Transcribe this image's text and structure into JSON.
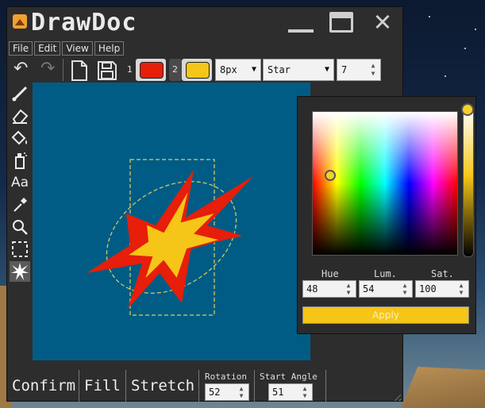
{
  "app": {
    "title": "DrawDoc"
  },
  "menu": [
    "File",
    "Edit",
    "View",
    "Help"
  ],
  "toolbar": {
    "color1_index": "1",
    "color2_index": "2",
    "color1": "#e61e0a",
    "color2": "#f5c518",
    "size_value": "8px",
    "shape_value": "Star",
    "points_value": "7"
  },
  "tools": [
    "brush-icon",
    "eraser-icon",
    "fill-bucket-icon",
    "spray-icon",
    "text-icon",
    "eyedropper-icon",
    "zoom-icon",
    "select-icon",
    "star-tool-icon"
  ],
  "tool_text": {
    "text_tool_glyph": "Aa"
  },
  "canvas": {
    "background": "#005c85"
  },
  "bottom": {
    "confirm_label": "Confirm",
    "fill_label": "Fill",
    "stretch_label": "Stretch",
    "rotation_label": "Rotation",
    "rotation_value": "52",
    "start_angle_label": "Start Angle",
    "start_angle_value": "51"
  },
  "color_picker": {
    "hue_label": "Hue",
    "lum_label": "Lum.",
    "sat_label": "Sat.",
    "hue_value": "48",
    "lum_value": "54",
    "sat_value": "100",
    "apply_label": "Apply"
  }
}
